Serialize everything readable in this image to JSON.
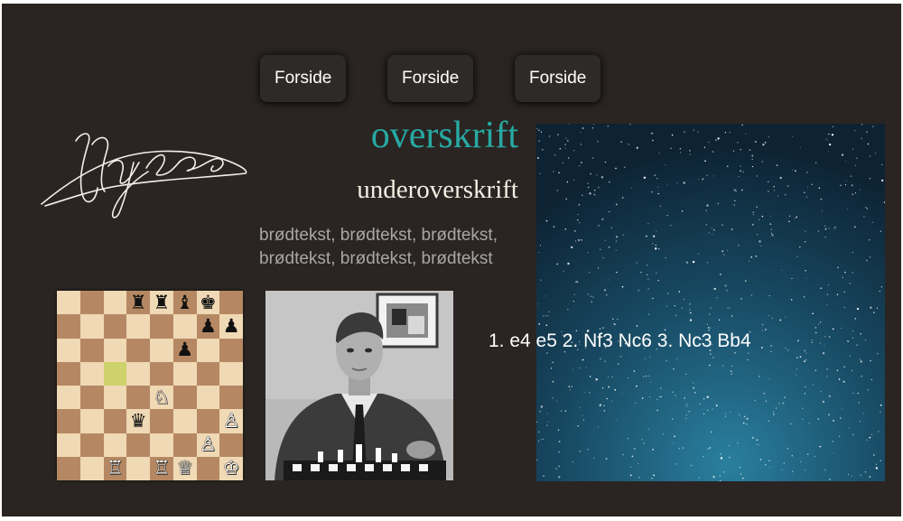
{
  "nav": {
    "items": [
      {
        "label": "Forside"
      },
      {
        "label": "Forside"
      },
      {
        "label": "Forside"
      }
    ]
  },
  "content": {
    "headline": "overskrift",
    "subheadline": "underoverskrift",
    "body_line1": "brødtekst, brødtekst, brødtekst,",
    "body_line2": "brødtekst, brødtekst, brødtekst",
    "moves": "1. e4 e5 2. Nf3 Nc6 3. Nc3 Bb4"
  },
  "board": {
    "highlight": "c5",
    "ranks": [
      [
        "",
        "",
        "",
        "♜",
        "♜",
        "♝",
        "♚",
        ""
      ],
      [
        "",
        "",
        "",
        "",
        "",
        "",
        "♟",
        "♟"
      ],
      [
        "",
        "",
        "",
        "",
        "",
        "♟",
        "",
        ""
      ],
      [
        "",
        "",
        "",
        "",
        "",
        "",
        "",
        ""
      ],
      [
        "",
        "",
        "",
        "",
        "♘",
        "",
        "",
        ""
      ],
      [
        "",
        "",
        "",
        "♛",
        "",
        "",
        "",
        "♙"
      ],
      [
        "",
        "",
        "",
        "",
        "",
        "",
        "♙",
        ""
      ],
      [
        "",
        "",
        "♖",
        "",
        "♖",
        "♕",
        "",
        "♔"
      ]
    ]
  },
  "colors": {
    "background": "#2a2522",
    "accent": "#27a9a3",
    "body_text": "#a7a7a7",
    "button_bg": "#2e2a27"
  },
  "icons": {
    "signature": "handwritten-signature",
    "portrait": "chess-player-photo",
    "starfield": "night-sky-stars"
  }
}
